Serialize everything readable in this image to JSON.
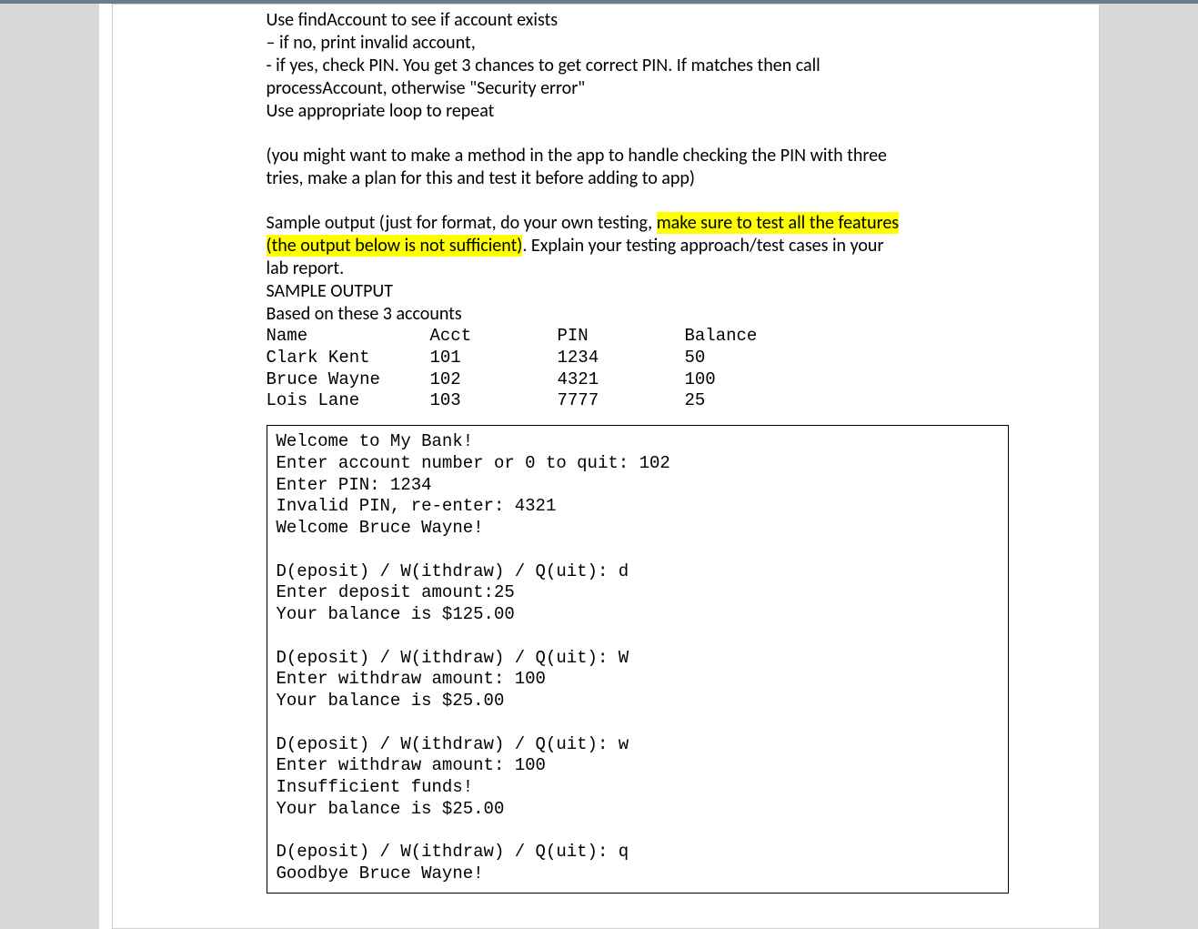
{
  "instructions": {
    "l1": "Use findAccount to see if account exists",
    "l2": " – if no, print invalid account,",
    "l3": " -  if yes, check PIN.  You get 3 chances to get correct PIN. If matches then call",
    "l4": "processAccount, otherwise \"Security error\"",
    "l5": "Use appropriate loop to repeat",
    "l6": "(you might want to make a method in the app to handle checking the PIN with three",
    "l7": "tries, make a plan for this and test it before adding to app)",
    "l8a": "Sample output (just for format, do your own testing, ",
    "l8b_hl": "make sure to test all the features",
    "l9a_hl": "(the output below is not sufficient)",
    "l9b": ".  Explain your testing approach/test cases in your",
    "l10": "lab report.",
    "l11": "SAMPLE OUTPUT",
    "l12": "Based on these 3 accounts"
  },
  "accounts_header": {
    "name": "Name",
    "acct": "Acct",
    "pin": "PIN",
    "bal": "Balance"
  },
  "accounts": [
    {
      "name": "Clark Kent",
      "acct": "101",
      "pin": "1234",
      "bal": "50"
    },
    {
      "name": "Bruce Wayne",
      "acct": "102",
      "pin": "4321",
      "bal": "100"
    },
    {
      "name": "Lois Lane",
      "acct": "103",
      "pin": "7777",
      "bal": "25"
    }
  ],
  "sample_output": "Welcome to My Bank!\nEnter account number or 0 to quit: 102\nEnter PIN: 1234\nInvalid PIN, re-enter: 4321\nWelcome Bruce Wayne!\n\nD(eposit) / W(ithdraw) / Q(uit): d\nEnter deposit amount:25\nYour balance is $125.00\n\nD(eposit) / W(ithdraw) / Q(uit): W\nEnter withdraw amount: 100\nYour balance is $25.00\n\nD(eposit) / W(ithdraw) / Q(uit): w\nEnter withdraw amount: 100\nInsufficient funds!\nYour balance is $25.00\n\nD(eposit) / W(ithdraw) / Q(uit): q\nGoodbye Bruce Wayne!"
}
